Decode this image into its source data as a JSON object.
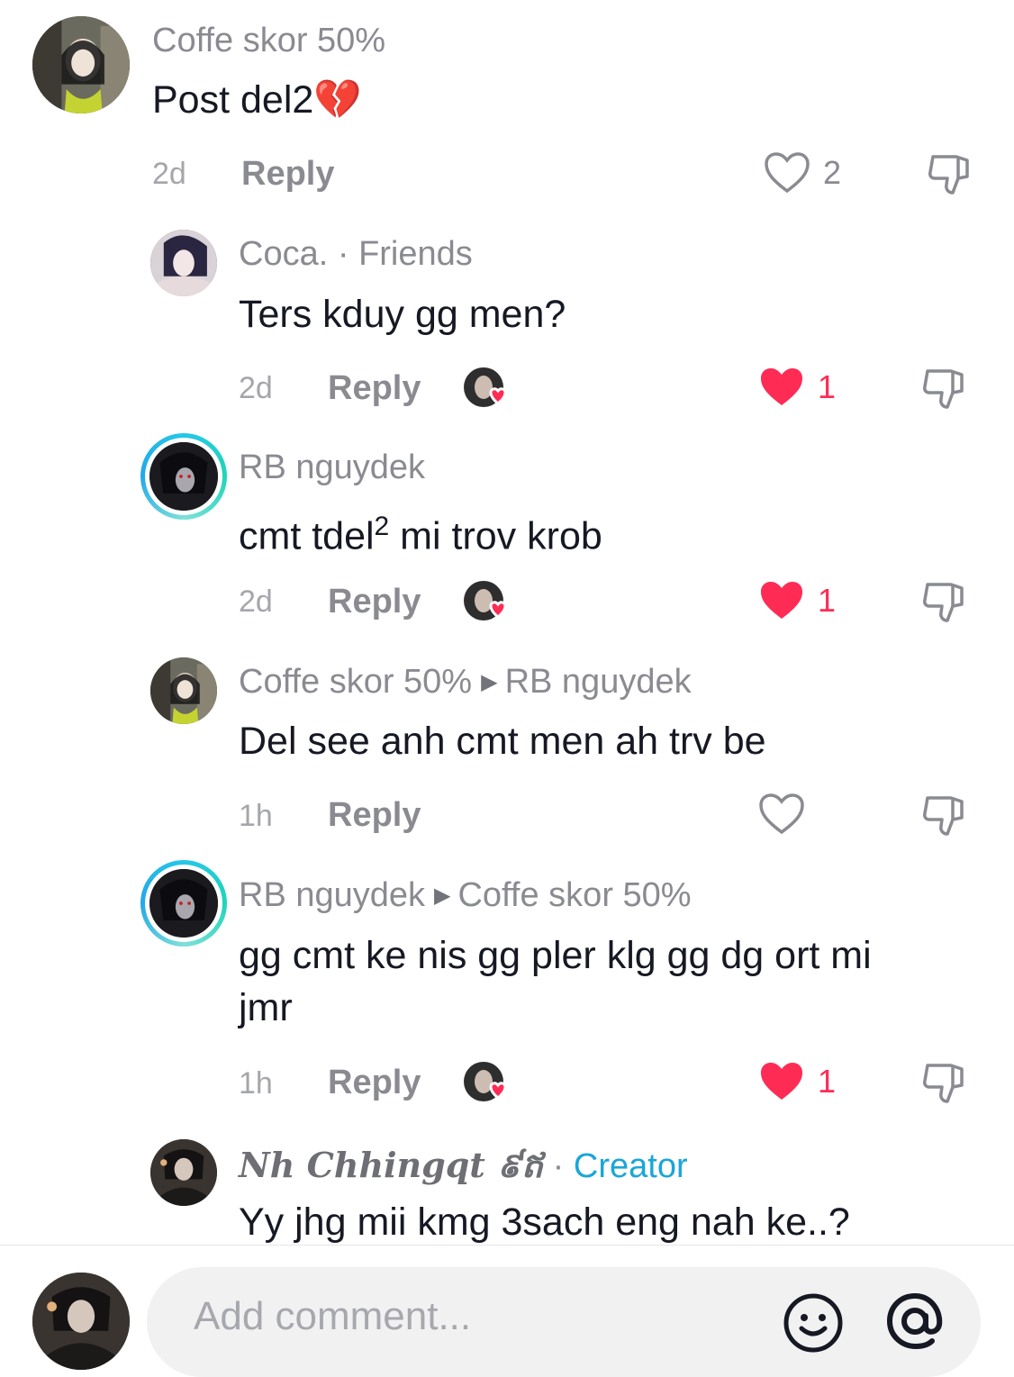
{
  "comments": [
    {
      "author": "Coffe skor 50%",
      "text": "Post del2💔",
      "time": "2d",
      "reply_label": "Reply",
      "likes": "2",
      "liked": false
    },
    {
      "author": "Coca.",
      "tag": "Friends",
      "text": "Ters kduy gg men?",
      "time": "2d",
      "reply_label": "Reply",
      "likes": "1",
      "liked": true
    },
    {
      "author": "RB nguydek",
      "text_main": "cmt tdel",
      "text_sup": "2",
      "text_rest": " mi trov krob",
      "time": "2d",
      "reply_label": "Reply",
      "likes": "1",
      "liked": true
    },
    {
      "author": "Coffe skor 50%",
      "reply_to": "RB nguydek",
      "text": "Del see anh cmt men ah trv be",
      "time": "1h",
      "reply_label": "Reply",
      "likes": "",
      "liked": false
    },
    {
      "author": "RB nguydek",
      "reply_to": "Coffe skor 50%",
      "text_line1": "gg cmt ke nis gg pler klg gg dg ort mi",
      "text_line2": "jmr",
      "time": "1h",
      "reply_label": "Reply",
      "likes": "1",
      "liked": true
    },
    {
      "author": "Nh Chhingqt ៩ឥ",
      "tag": "Creator",
      "text": "Yy jhg mii kmg 3sach eng nah ke..?"
    }
  ],
  "separator": "·",
  "composer": {
    "placeholder": "Add comment..."
  },
  "colors": {
    "like_red": "#fe2c55",
    "creator_blue": "#1aa6d8",
    "muted_text": "#8a8b91"
  },
  "icons": [
    "heart-outline-icon",
    "heart-filled-icon",
    "dislike-icon",
    "emoji-icon",
    "at-mention-icon"
  ]
}
